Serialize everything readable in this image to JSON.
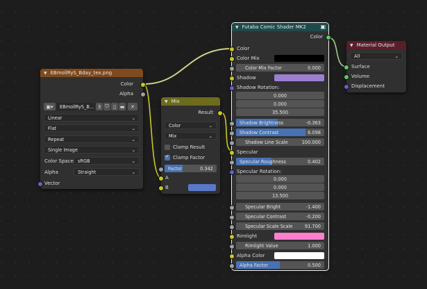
{
  "image_node": {
    "title": "EBmollRyS_Bday_tex.png",
    "outputs": [
      "Color",
      "Alpha"
    ],
    "image_name": "EBmollRyS_B...",
    "users": "3",
    "interpolation": "Linear",
    "projection": "Flat",
    "extension": "Repeat",
    "source": "Single Image",
    "color_space_label": "Color Space",
    "color_space": "sRGB",
    "alpha_label": "Alpha",
    "alpha": "Straight",
    "vector_label": "Vector",
    "header_color": "#7e4a1e"
  },
  "mix_node": {
    "title": "Mix",
    "output": "Result",
    "data_type": "Color",
    "blend": "Mix",
    "clamp_result": "Clamp Result",
    "clamp_factor": "Clamp Factor",
    "factor_label": "Factor",
    "factor_value": "0.342",
    "factor_fraction": 0.342,
    "input_a": "A",
    "input_b": "B",
    "b_color": "#5a78c8",
    "header_color": "#6c6b1e"
  },
  "shader_node": {
    "title": "Futaba Comic Shader MK2",
    "output": "Color",
    "header_color": "#1f4a4a",
    "rows": {
      "color": "Color",
      "color_mix": "Color Mix",
      "color_mix_factor_label": "Color Mix Factor",
      "color_mix_factor": "0.000",
      "shadow": "Shadow",
      "shadow_rotation": "Shadow Rotation:",
      "shadow_rot": [
        "0.000",
        "0.000",
        "35.500"
      ],
      "shadow_brightness_label": "Shadow Brightness",
      "shadow_brightness": "-0.363",
      "shadow_contrast_label": "Shadow Contrast",
      "shadow_contrast": "6.098",
      "shadow_line_scale_label": "Shadow Line Scale",
      "shadow_line_scale": "100.000",
      "specular": "Specular",
      "specular_roughness_label": "Specular Roughness",
      "specular_roughness": "0.402",
      "specular_rotation": "Specular Rotation:",
      "specular_rot": [
        "0.000",
        "0.000",
        "13.500"
      ],
      "specular_bright_label": "Specular Bright",
      "specular_bright": "-1.400",
      "specular_contrast_label": "Specular Contrast",
      "specular_contrast": "-0.200",
      "specular_scale_label": "Specular Scale Scale",
      "specular_scale": "91.700",
      "rimlight": "Rimlight",
      "rimlight_value_label": "Rimlight Value",
      "rimlight_value": "1.000",
      "alpha_color": "Alpha Color",
      "alpha_factor_label": "Alpha Factor",
      "alpha_factor": "0.500"
    },
    "colors": {
      "color_mix": "#000000",
      "shadow": "#9c7fd0",
      "rimlight": "#ff7fcf",
      "alpha_color": "#ffffff"
    }
  },
  "output_node": {
    "title": "Material Output",
    "target": "All",
    "inputs": [
      "Surface",
      "Volume",
      "Displacement"
    ],
    "header_color": "#5a1e2a"
  }
}
